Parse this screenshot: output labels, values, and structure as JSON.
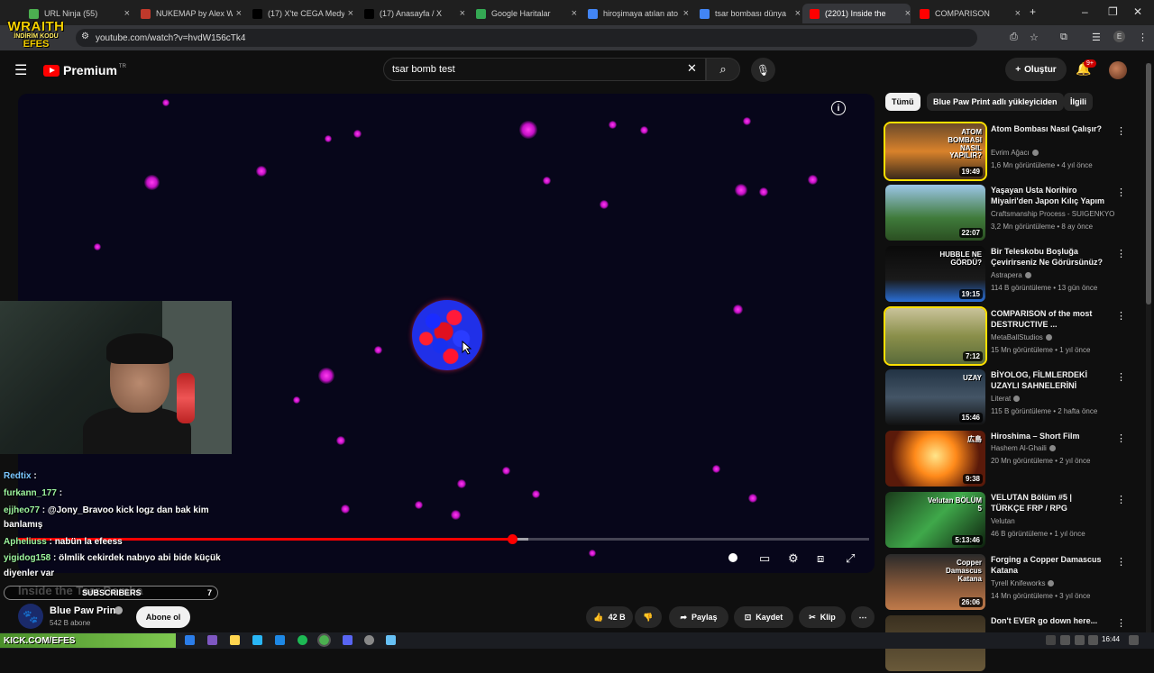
{
  "browser": {
    "tabs": [
      {
        "title": "URL Ninja (55)",
        "color": "#4caf50"
      },
      {
        "title": "NUKEMAP by Alex W",
        "color": "#c0392b"
      },
      {
        "title": "(17) X'te CEGA Medy",
        "color": "#000000"
      },
      {
        "title": "(17) Anasayfa / X",
        "color": "#000000"
      },
      {
        "title": "Google Haritalar",
        "color": "#34a853"
      },
      {
        "title": "hiroşimaya atılan ato",
        "color": "#4285f4"
      },
      {
        "title": "tsar bombası dünya",
        "color": "#4285f4"
      },
      {
        "title": "(2201) Inside the",
        "color": "#ff0000"
      },
      {
        "title": "COMPARISON",
        "color": "#ff0000"
      }
    ],
    "new_tab": "+",
    "url": "youtube.com/watch?v=hvdW156cTk4"
  },
  "overlay_logo": {
    "line1": "WRAITH",
    "line2": "İNDİRİM KODU",
    "line3": "EFES"
  },
  "youtube": {
    "logo_text": "Premium",
    "logo_region": "TR",
    "search_value": "tsar bomb test",
    "create_label": "Oluştur",
    "notif_badge": "9+"
  },
  "player": {
    "progress_fraction": 0.58,
    "buffer_fraction": 0.6
  },
  "chat": [
    {
      "user": "Redtix",
      "text": "",
      "user_color": "blue"
    },
    {
      "user": "furkann_177",
      "text": "",
      "user_color": "green"
    },
    {
      "user": "ejjheo77",
      "text": "@Jony_Bravoo kick logz dan bak kim",
      "user_color": "green"
    },
    {
      "user": "",
      "text": "banlamış",
      "user_color": "green"
    },
    {
      "user": "Apheliuss",
      "text": "nabün la efeess",
      "user_color": "green"
    },
    {
      "user": "yigidog158",
      "text": "ölmlik cekirdek nabıyo abi bide küçük",
      "user_color": "green"
    },
    {
      "user": "",
      "text": "diyenler var",
      "user_color": "green"
    }
  ],
  "subs_bar": {
    "label": "SUBSCRIBERS",
    "count": "7"
  },
  "video": {
    "title_partial": "Inside the Tsar Bomba"
  },
  "channel": {
    "name": "Blue Paw Print",
    "subs": "542 B abone",
    "subscribe_label": "Abone ol"
  },
  "actions": {
    "like_count": "42 B",
    "share": "Paylaş",
    "save": "Kaydet",
    "clip": "Klip"
  },
  "chips": [
    "Tümü",
    "Blue Paw Print adlı yükleyiciden",
    "İlgili"
  ],
  "recommendations": [
    {
      "title": "Atom Bombası Nasıl Çalışır?",
      "channel": "Evrim Ağacı",
      "verified": true,
      "meta": "1,6 Mn görüntüleme • 4 yıl önce",
      "duration": "19:49",
      "thumb": "linear-gradient(180deg,#6b4a2a,#d9822b 50%,#3a2a1a)",
      "thumb_text": "ATOM BOMBASI NASIL YAPILIR?"
    },
    {
      "title": "Yaşayan Usta Norihiro Miyairi'den Japon Kılıç Yapım ...",
      "channel": "Craftsmanship Process - SUIGENKYO",
      "verified": false,
      "meta": "3,2 Mn görüntüleme • 8 ay önce",
      "duration": "22:07",
      "thumb": "linear-gradient(180deg,#9cc6e8,#3f7a3a 60%,#2b4f22)",
      "thumb_text": ""
    },
    {
      "title": "Bir Teleskobu Boşluğa Çevirirseniz Ne Görürsünüz?",
      "channel": "Astrapera",
      "verified": true,
      "meta": "114 B görüntüleme • 13 gün önce",
      "duration": "19:15",
      "thumb": "linear-gradient(180deg,#0a0a0a,#1a1a1a 60%,#2a6fd6)",
      "thumb_text": "HUBBLE NE GÖRDÜ?"
    },
    {
      "title": "COMPARISON of the most DESTRUCTIVE ...",
      "channel": "MetaBallStudios",
      "verified": true,
      "meta": "15 Mn görüntüleme • 1 yıl önce",
      "duration": "7:12",
      "thumb": "linear-gradient(180deg,#c9c39a,#8a8f4a 50%,#5a6b3a)",
      "thumb_text": ""
    },
    {
      "title": "BİYOLOG, FİLMLERDEKİ UZAYLI SAHNELERİNİ YORUMLUYOR!",
      "channel": "Literat",
      "verified": true,
      "meta": "115 B görüntüleme • 2 hafta önce",
      "duration": "15:46",
      "thumb": "linear-gradient(180deg,#223344,#445566 50%,#111)",
      "thumb_text": "UZAY"
    },
    {
      "title": "Hiroshima – Short Film",
      "channel": "Hashem Al-Ghaili",
      "verified": true,
      "meta": "20 Mn görüntüleme • 2 yıl önce",
      "duration": "9:38",
      "thumb": "radial-gradient(circle at 50% 45%,#ffe58a,#ff8a1a 35%,#5a1a0a 75%)",
      "thumb_text": "広島"
    },
    {
      "title": "VELUTAN Bölüm #5 | TÜRKÇE FRP / RPG w/@Swaggybark ...",
      "channel": "Velutan",
      "verified": false,
      "meta": "46 B görüntüleme • 1 yıl önce",
      "duration": "5:13:46",
      "thumb": "linear-gradient(135deg,#1a3a1a,#3fa84a 50%,#0d1f0d)",
      "thumb_text": "Velutan BÖLÜM 5"
    },
    {
      "title": "Forging a Copper Damascus Katana",
      "channel": "Tyrell Knifeworks",
      "verified": true,
      "meta": "14 Mn görüntüleme • 3 yıl önce",
      "duration": "26:06",
      "thumb": "linear-gradient(180deg,#2a2a2a,#8a5a3a 60%,#c07a4a)",
      "thumb_text": "Copper Damascus Katana"
    },
    {
      "title": "Don't EVER go down here...",
      "channel": "",
      "verified": false,
      "meta": "",
      "duration": "",
      "thumb": "linear-gradient(180deg,#3a3020,#6a5a3a)",
      "thumb_text": ""
    }
  ],
  "taskbar": {
    "banner": "KICK.COM/EFES",
    "clock": "16:44"
  }
}
